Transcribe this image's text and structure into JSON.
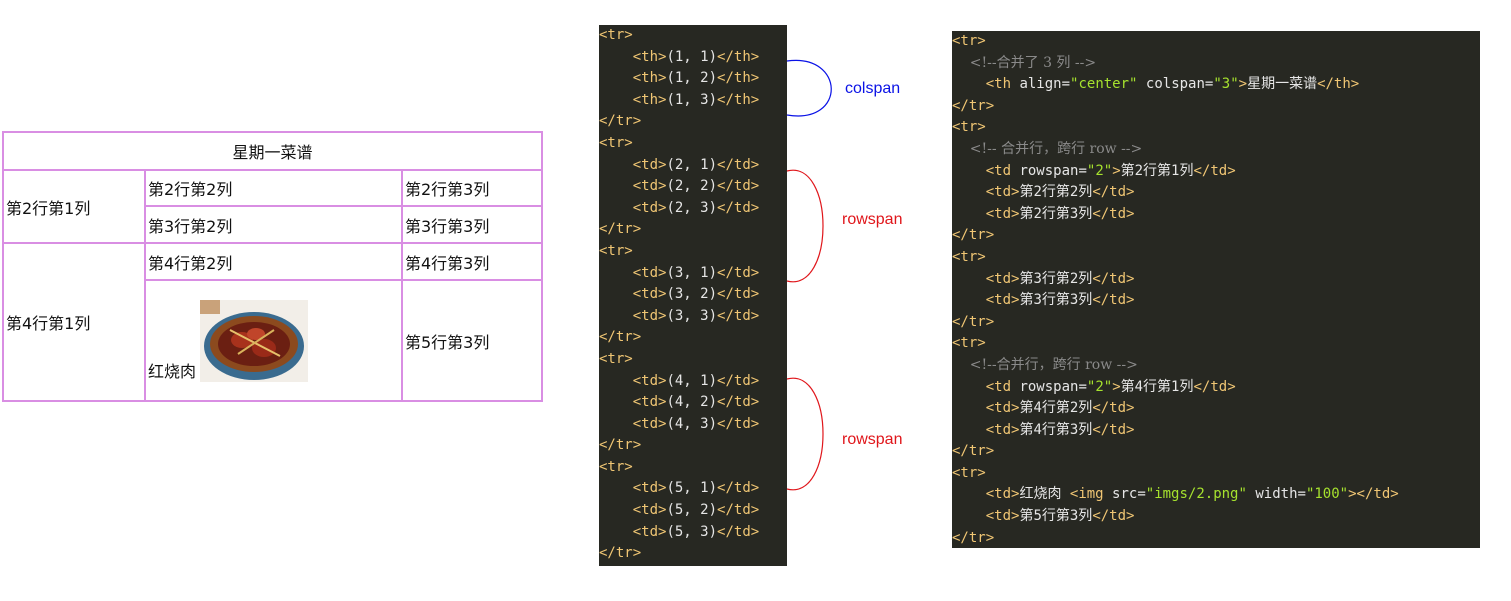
{
  "table": {
    "header": "星期一菜谱",
    "r2c1": "第2行第1列",
    "r2c2": "第2行第2列",
    "r2c3": "第2行第3列",
    "r3c2": "第3行第2列",
    "r3c3": "第3行第3列",
    "r4c1": "第4行第1列",
    "r4c2": "第4行第2列",
    "r4c3": "第4行第3列",
    "r5c2": "红烧肉",
    "r5c3": "第5行第3列"
  },
  "annotations": {
    "colspan": "colspan",
    "rowspan1": "rowspan",
    "rowspan2": "rowspan",
    "colors": {
      "colspan": "#0a12e6",
      "rowspan": "#e0161b",
      "border": "#d98ee3"
    }
  },
  "code_left": [
    "<tr>",
    "    <th>(1, 1)</th>",
    "    <th>(1, 2)</th>",
    "    <th>(1, 3)</th>",
    "</tr>",
    "<tr>",
    "    <td>(2, 1)</td>",
    "    <td>(2, 2)</td>",
    "    <td>(2, 3)</td>",
    "</tr>",
    "<tr>",
    "    <td>(3, 1)</td>",
    "    <td>(3, 2)</td>",
    "    <td>(3, 3)</td>",
    "</tr>",
    "<tr>",
    "    <td>(4, 1)</td>",
    "    <td>(4, 2)</td>",
    "    <td>(4, 3)</td>",
    "</tr>",
    "<tr>",
    "    <td>(5, 1)</td>",
    "    <td>(5, 2)</td>",
    "    <td>(5, 3)</td>",
    "</tr>"
  ],
  "code_right": [
    "<tr>",
    "    <!--合并了 3 列 -->",
    "    <th align=\"center\" colspan=\"3\">星期一菜谱</th>",
    "</tr>",
    "<tr>",
    "    <!-- 合并行，跨行 row -->",
    "    <td rowspan=\"2\">第2行第1列</td>",
    "    <td>第2行第2列</td>",
    "    <td>第2行第3列</td>",
    "</tr>",
    "<tr>",
    "    <td>第3行第2列</td>",
    "    <td>第3行第3列</td>",
    "</tr>",
    "<tr>",
    "    <!--合并行，跨行 row -->",
    "    <td rowspan=\"2\">第4行第1列</td>",
    "    <td>第4行第2列</td>",
    "    <td>第4行第3列</td>",
    "</tr>",
    "<tr>",
    "    <td>红烧肉 <img src=\"imgs/2.png\" width=\"100\"></td>",
    "    <td>第5行第3列</td>",
    "</tr>"
  ]
}
